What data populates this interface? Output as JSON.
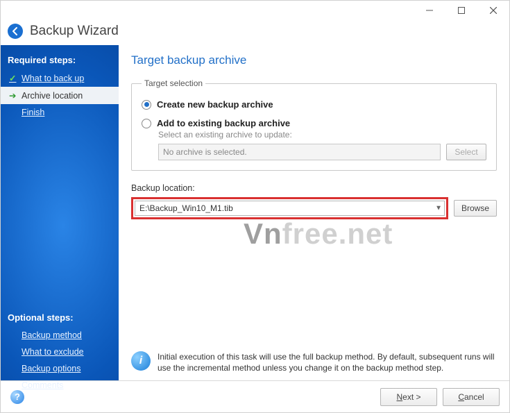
{
  "window": {
    "title": "Backup Wizard"
  },
  "sidebar": {
    "required_heading": "Required steps:",
    "optional_heading": "Optional steps:",
    "items": {
      "what_to_back_up": "What to back up",
      "archive_location": "Archive location",
      "finish": "Finish",
      "backup_method": "Backup method",
      "what_to_exclude": "What to exclude",
      "backup_options": "Backup options",
      "comments": "Comments"
    }
  },
  "main": {
    "title": "Target backup archive",
    "group_legend": "Target selection",
    "radio_create": "Create new backup archive",
    "radio_add": "Add to existing backup archive",
    "add_subtext": "Select an existing archive to update:",
    "archive_placeholder": "No archive is selected.",
    "select_btn": "Select",
    "location_label": "Backup location:",
    "location_value": "E:\\Backup_Win10_M1.tib",
    "browse_btn": "Browse",
    "info_text": "Initial execution of this task will use the full backup method. By default, subsequent runs will use the incremental method unless you change it on the backup method step."
  },
  "footer": {
    "next": "Next >",
    "next_key": "N",
    "cancel": "Cancel",
    "cancel_key": "C"
  },
  "watermark": {
    "a": "Vn",
    "b": "free.net"
  }
}
